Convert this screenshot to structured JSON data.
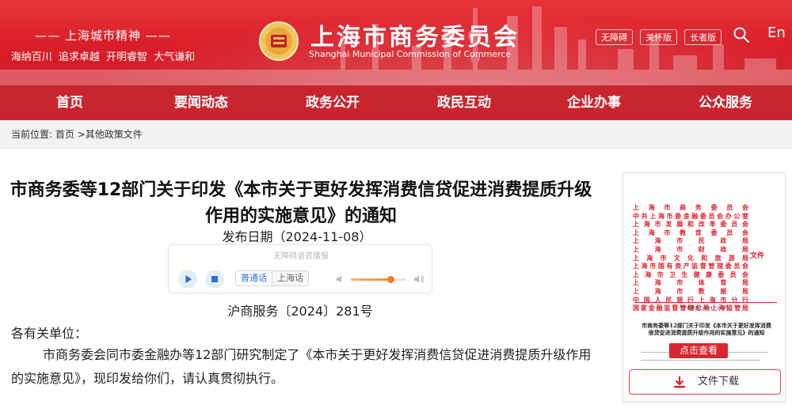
{
  "header": {
    "motto_title": "—— 上海城市精神 ——",
    "motto_values": "海纳百川  追求卓越  开明睿智  大气谦和",
    "site_title": "上海市商务委员会",
    "site_subtitle": "Shanghai Municipal Commission of Commerce",
    "tools": [
      "无障碍",
      "关怀版",
      "长者版"
    ],
    "language": "En"
  },
  "nav": [
    "首页",
    "要闻动态",
    "政务公开",
    "政民互动",
    "企业办事",
    "公众服务"
  ],
  "breadcrumb": {
    "label": "当前位置:",
    "path": "首页 >其他政策文件"
  },
  "article": {
    "title": "市商务委等12部门关于印发《本市关于更好发挥消费信贷促进消费提质升级作用的实施意见》的通知",
    "publish_date": "发布日期（2024-11-08）",
    "doc_number": "沪商服务〔2024〕281号",
    "salutation": "各有关单位：",
    "body": "市商务委会同市委金融办等12部门研究制定了《本市关于更好发挥消费信贷促进消费提质升级作用的实施意见》，现印发给你们，请认真贯彻执行。"
  },
  "player": {
    "hint": "无障碍语音播报",
    "mode_active": "普通话",
    "mode_inactive": "上海话",
    "volume": 0.72
  },
  "doc_card": {
    "agencies": [
      "上海市商务委员会",
      "中共上海市委金融委员会办公室",
      "上海市发展和改革委员会",
      "上海市教育委员会",
      "上海市民政局",
      "上海市财政局",
      "上海市文化和旅游局",
      "上海市国有资产监督管理委员会",
      "上海市卫生健康委员会",
      "上海市体育局",
      "上海市数据局",
      "中国人民银行上海市分行",
      "国家金融监督管理总局上海监管局"
    ],
    "wenjian": "文件",
    "mini_doc_number": "沪商服务〔2024〕281号",
    "mini_title": "市商务委等12部门关于印发《本市关于更好发挥消费信贷促进消费提质升级作用的实施意见》的通知",
    "view_button": "点击查看",
    "download_button": "文件下载"
  },
  "colors": {
    "brand_red": "#d91f29",
    "nav_red": "#c4121c",
    "accent_orange": "#f07d1e",
    "link_blue": "#2a6fd6"
  }
}
